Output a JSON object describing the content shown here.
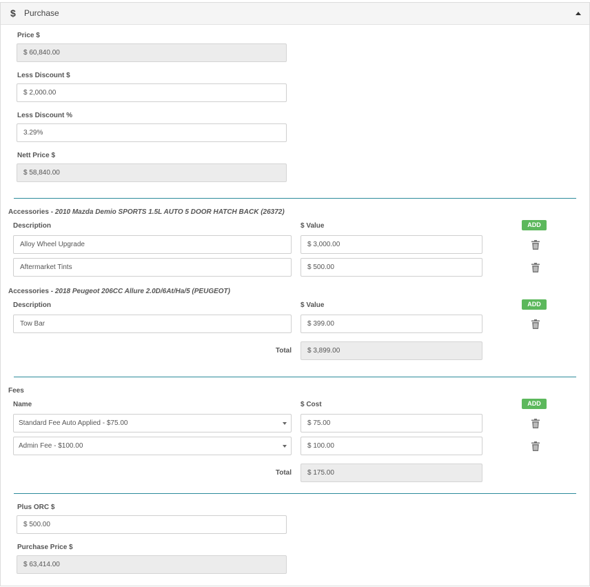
{
  "header": {
    "icon": "dollar-icon",
    "title": "Purchase"
  },
  "price": {
    "label": "Price $",
    "value": "$ 60,840.00"
  },
  "less_discount": {
    "label": "Less Discount $",
    "value": "$ 2,000.00"
  },
  "less_discount_pct": {
    "label": "Less Discount %",
    "value": "3.29%"
  },
  "nett_price": {
    "label": "Nett Price $",
    "value": "$ 58,840.00"
  },
  "accessories": [
    {
      "title_prefix": "Accessories - ",
      "title_vehicle": "2010 Mazda Demio SPORTS 1.5L AUTO 5 DOOR HATCH BACK (26372)",
      "col_description": "Description",
      "col_value": "$ Value",
      "add_label": "ADD",
      "rows": [
        {
          "description": "Alloy Wheel Upgrade",
          "value": "$ 3,000.00"
        },
        {
          "description": "Aftermarket Tints",
          "value": "$ 500.00"
        }
      ]
    },
    {
      "title_prefix": "Accessories - ",
      "title_vehicle": "2018 Peugeot 206CC Allure 2.0D/6At/Ha/5 (PEUGEOT)",
      "col_description": "Description",
      "col_value": "$ Value",
      "add_label": "ADD",
      "rows": [
        {
          "description": "Tow Bar",
          "value": "$ 399.00"
        }
      ]
    }
  ],
  "accessories_total": {
    "label": "Total",
    "value": "$ 3,899.00"
  },
  "fees": {
    "title": "Fees",
    "col_name": "Name",
    "col_cost": "$ Cost",
    "add_label": "ADD",
    "rows": [
      {
        "name": "Standard Fee Auto Applied - $75.00",
        "cost": "$ 75.00"
      },
      {
        "name": "Admin Fee - $100.00",
        "cost": "$ 100.00"
      }
    ],
    "total_label": "Total",
    "total_value": "$ 175.00"
  },
  "plus_orc": {
    "label": "Plus ORC $",
    "value": "$ 500.00"
  },
  "purchase_price": {
    "label": "Purchase Price $",
    "value": "$ 63,414.00"
  },
  "colors": {
    "accent": "#2b8a9a",
    "add_button": "#5cb85c",
    "readonly_bg": "#ececec"
  }
}
